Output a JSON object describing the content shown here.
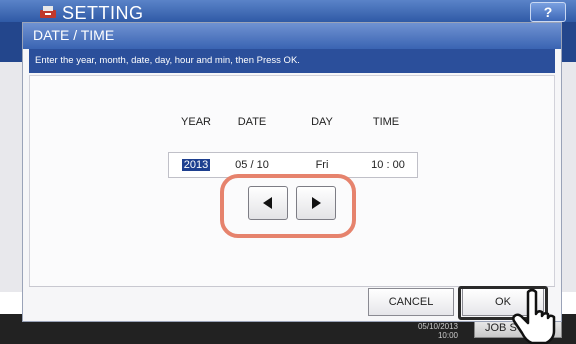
{
  "app": {
    "title": "SETTING",
    "help_label": "?",
    "footer_date": "05/10/2013",
    "footer_time": "10:00",
    "job_button_label": "JOB S"
  },
  "dialog": {
    "title": "DATE / TIME",
    "instruction": "Enter the year, month, date, day, hour and min, then Press OK.",
    "columns": [
      {
        "header": "YEAR",
        "value": "2013",
        "selected": true
      },
      {
        "header": "DATE",
        "value": "05 / 10",
        "selected": false
      },
      {
        "header": "DAY",
        "value": "Fri",
        "selected": false
      },
      {
        "header": "TIME",
        "value": "10 : 00",
        "selected": false
      }
    ],
    "left_arrow_icon": "triangle-left-icon",
    "right_arrow_icon": "triangle-right-icon",
    "cancel_label": "CANCEL",
    "ok_label": "OK"
  },
  "colors": {
    "title_bar": "#3a64b2",
    "instruction_bar": "#2b4f9b",
    "highlight_ring": "#e6836d",
    "selection": "#1d3f8f"
  }
}
